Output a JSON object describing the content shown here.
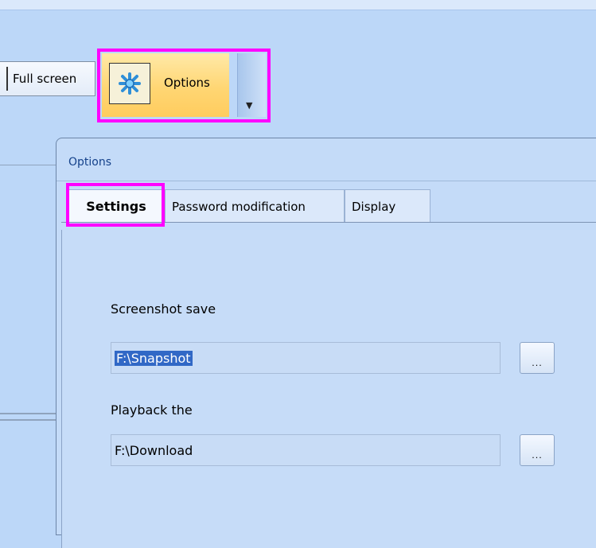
{
  "toolbar": {
    "fullscreen_label": "Full screen",
    "options_label": "Options",
    "options_icon": "gear-icon",
    "dropdown_icon": "chevron-down-icon"
  },
  "dialog": {
    "title": "Options",
    "tabs": [
      {
        "label": "Settings",
        "active": true
      },
      {
        "label": "Password modification"
      },
      {
        "label": "Display"
      }
    ],
    "fields": [
      {
        "label": "Screenshot save",
        "value": "F:\\Snapshot",
        "browse_label": "..."
      },
      {
        "label": "Playback the",
        "value": "F:\\Download",
        "browse_label": "..."
      }
    ]
  },
  "colors": {
    "highlight": "#ff00ff",
    "selection": "#3168c6",
    "active_button": "#ffd673"
  }
}
